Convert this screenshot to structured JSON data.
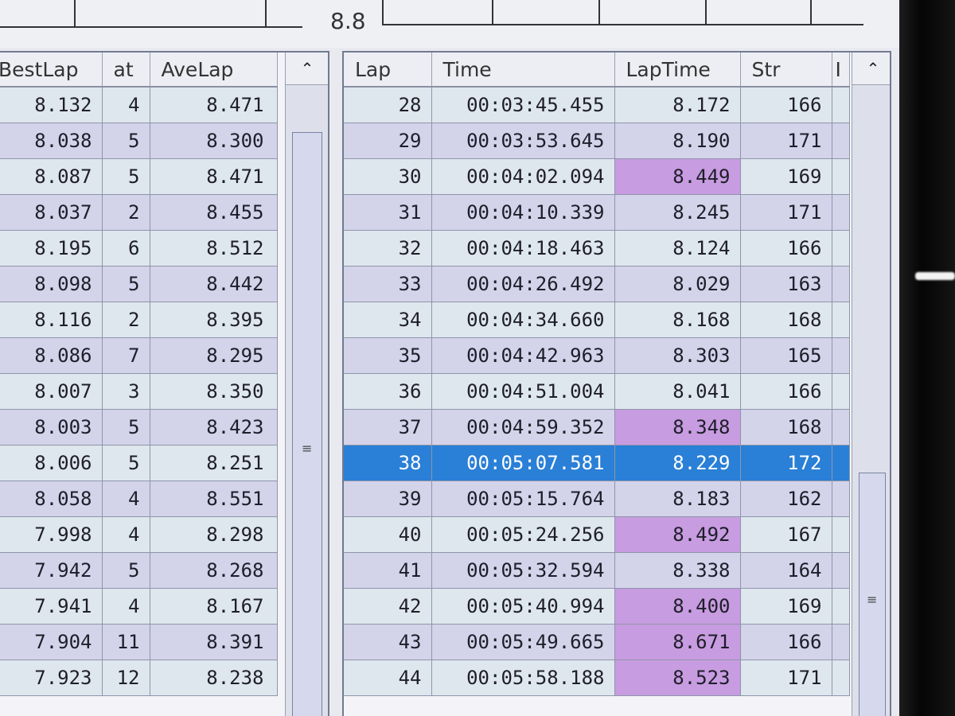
{
  "top_graph": {
    "axis_value": "8.8"
  },
  "left_table": {
    "columns": [
      "BestLap",
      "at",
      "AveLap"
    ],
    "rows": [
      [
        "8.132",
        "4",
        "8.471"
      ],
      [
        "8.038",
        "5",
        "8.300"
      ],
      [
        "8.087",
        "5",
        "8.471"
      ],
      [
        "8.037",
        "2",
        "8.455"
      ],
      [
        "8.195",
        "6",
        "8.512"
      ],
      [
        "8.098",
        "5",
        "8.442"
      ],
      [
        "8.116",
        "2",
        "8.395"
      ],
      [
        "8.086",
        "7",
        "8.295"
      ],
      [
        "8.007",
        "3",
        "8.350"
      ],
      [
        "8.003",
        "5",
        "8.423"
      ],
      [
        "8.006",
        "5",
        "8.251"
      ],
      [
        "8.058",
        "4",
        "8.551"
      ],
      [
        "7.998",
        "4",
        "8.298"
      ],
      [
        "7.942",
        "5",
        "8.268"
      ],
      [
        "7.941",
        "4",
        "8.167"
      ],
      [
        "7.904",
        "11",
        "8.391"
      ],
      [
        "7.923",
        "12",
        "8.238"
      ]
    ],
    "scroll_up_icon": "chevron-up-icon",
    "grip_icon": "grip-lines-icon"
  },
  "right_table": {
    "columns": [
      "Lap",
      "Time",
      "LapTime",
      "Str",
      "I"
    ],
    "selected_lap": "38",
    "highlight_color": "#c89ce0",
    "selection_color": "#2a7fd6",
    "rows": [
      {
        "lap": "28",
        "time": "00:03:45.455",
        "laptime": "8.172",
        "str": "166",
        "hl": false
      },
      {
        "lap": "29",
        "time": "00:03:53.645",
        "laptime": "8.190",
        "str": "171",
        "hl": false
      },
      {
        "lap": "30",
        "time": "00:04:02.094",
        "laptime": "8.449",
        "str": "169",
        "hl": true
      },
      {
        "lap": "31",
        "time": "00:04:10.339",
        "laptime": "8.245",
        "str": "171",
        "hl": false
      },
      {
        "lap": "32",
        "time": "00:04:18.463",
        "laptime": "8.124",
        "str": "166",
        "hl": false
      },
      {
        "lap": "33",
        "time": "00:04:26.492",
        "laptime": "8.029",
        "str": "163",
        "hl": false
      },
      {
        "lap": "34",
        "time": "00:04:34.660",
        "laptime": "8.168",
        "str": "168",
        "hl": false
      },
      {
        "lap": "35",
        "time": "00:04:42.963",
        "laptime": "8.303",
        "str": "165",
        "hl": false
      },
      {
        "lap": "36",
        "time": "00:04:51.004",
        "laptime": "8.041",
        "str": "166",
        "hl": false
      },
      {
        "lap": "37",
        "time": "00:04:59.352",
        "laptime": "8.348",
        "str": "168",
        "hl": true
      },
      {
        "lap": "38",
        "time": "00:05:07.581",
        "laptime": "8.229",
        "str": "172",
        "hl": false
      },
      {
        "lap": "39",
        "time": "00:05:15.764",
        "laptime": "8.183",
        "str": "162",
        "hl": false
      },
      {
        "lap": "40",
        "time": "00:05:24.256",
        "laptime": "8.492",
        "str": "167",
        "hl": true
      },
      {
        "lap": "41",
        "time": "00:05:32.594",
        "laptime": "8.338",
        "str": "164",
        "hl": false
      },
      {
        "lap": "42",
        "time": "00:05:40.994",
        "laptime": "8.400",
        "str": "169",
        "hl": true
      },
      {
        "lap": "43",
        "time": "00:05:49.665",
        "laptime": "8.671",
        "str": "166",
        "hl": true
      },
      {
        "lap": "44",
        "time": "00:05:58.188",
        "laptime": "8.523",
        "str": "171",
        "hl": true
      }
    ],
    "scroll_up_icon": "chevron-up-icon",
    "grip_icon": "grip-lines-icon"
  }
}
